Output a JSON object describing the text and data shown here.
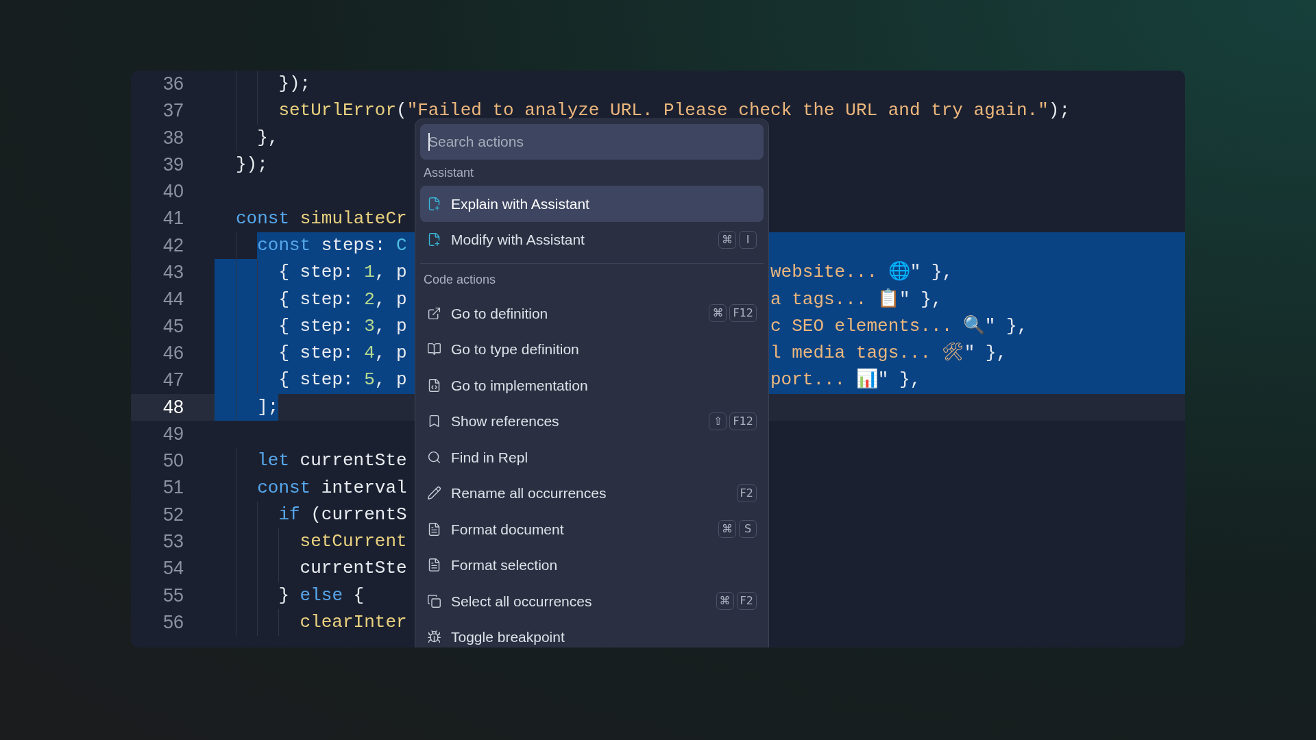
{
  "editor": {
    "lines": [
      {
        "number": "36",
        "selected": false,
        "current": false,
        "left": [
          {
            "t": "    });",
            "kind": "plain"
          }
        ]
      },
      {
        "number": "37",
        "selected": false,
        "current": false,
        "left": [
          {
            "t": "    setUrlError",
            "kind": "fn"
          },
          {
            "t": "(",
            "kind": "plain"
          },
          {
            "t": "\"Failed to analyze URL. Please check the URL and try again.\"",
            "kind": "str"
          },
          {
            "t": ");",
            "kind": "plain"
          }
        ]
      },
      {
        "number": "38",
        "selected": false,
        "current": false,
        "left": [
          {
            "t": "  },",
            "kind": "plain"
          }
        ]
      },
      {
        "number": "39",
        "selected": false,
        "current": false,
        "left": [
          {
            "t": "});",
            "kind": "plain"
          }
        ]
      },
      {
        "number": "40",
        "selected": false,
        "current": false
      },
      {
        "number": "41",
        "selected": false,
        "current": false,
        "left": [
          {
            "t": "const ",
            "kind": "kw"
          },
          {
            "t": "simulateCr",
            "kind": "fn"
          }
        ]
      },
      {
        "number": "42",
        "selected": true,
        "current": false,
        "left": [
          {
            "t": "  const ",
            "kind": "kw"
          },
          {
            "t": "steps: ",
            "kind": "plain"
          },
          {
            "t": "C",
            "kind": "type"
          }
        ]
      },
      {
        "number": "43",
        "selected": true,
        "current": false,
        "left": [
          {
            "t": "    { step: ",
            "kind": "plain"
          },
          {
            "t": "1",
            "kind": "num"
          },
          {
            "t": ", p",
            "kind": "plain"
          }
        ],
        "right": [
          {
            "t": "website... 🌐",
            "kind": "str"
          },
          {
            "t": "\" },",
            "kind": "plain"
          }
        ]
      },
      {
        "number": "44",
        "selected": true,
        "current": false,
        "left": [
          {
            "t": "    { step: ",
            "kind": "plain"
          },
          {
            "t": "2",
            "kind": "num"
          },
          {
            "t": ", p",
            "kind": "plain"
          }
        ],
        "right": [
          {
            "t": "a tags... 📋",
            "kind": "str"
          },
          {
            "t": "\" },",
            "kind": "plain"
          }
        ]
      },
      {
        "number": "45",
        "selected": true,
        "current": false,
        "left": [
          {
            "t": "    { step: ",
            "kind": "plain"
          },
          {
            "t": "3",
            "kind": "num"
          },
          {
            "t": ", p",
            "kind": "plain"
          }
        ],
        "right": [
          {
            "t": "c SEO elements... 🔍",
            "kind": "str"
          },
          {
            "t": "\" },",
            "kind": "plain"
          }
        ]
      },
      {
        "number": "46",
        "selected": true,
        "current": false,
        "left": [
          {
            "t": "    { step: ",
            "kind": "plain"
          },
          {
            "t": "4",
            "kind": "num"
          },
          {
            "t": ", p",
            "kind": "plain"
          }
        ],
        "right": [
          {
            "t": "l media tags... 🛠",
            "kind": "str"
          },
          {
            "t": "\" },",
            "kind": "plain"
          }
        ]
      },
      {
        "number": "47",
        "selected": true,
        "current": false,
        "left": [
          {
            "t": "    { step: ",
            "kind": "plain"
          },
          {
            "t": "5",
            "kind": "num"
          },
          {
            "t": ", p",
            "kind": "plain"
          }
        ],
        "right": [
          {
            "t": "port... 📊",
            "kind": "str"
          },
          {
            "t": "\" },",
            "kind": "plain"
          }
        ]
      },
      {
        "number": "48",
        "selected": true,
        "current": true,
        "left": [
          {
            "t": "  ];",
            "kind": "plain"
          }
        ]
      },
      {
        "number": "49",
        "selected": false,
        "current": false
      },
      {
        "number": "50",
        "selected": false,
        "current": false,
        "left": [
          {
            "t": "  let ",
            "kind": "kw"
          },
          {
            "t": "currentSte",
            "kind": "plain"
          }
        ]
      },
      {
        "number": "51",
        "selected": false,
        "current": false,
        "left": [
          {
            "t": "  const ",
            "kind": "kw"
          },
          {
            "t": "interval",
            "kind": "plain"
          }
        ]
      },
      {
        "number": "52",
        "selected": false,
        "current": false,
        "left": [
          {
            "t": "    if ",
            "kind": "kw"
          },
          {
            "t": "(currentS",
            "kind": "plain"
          }
        ]
      },
      {
        "number": "53",
        "selected": false,
        "current": false,
        "left": [
          {
            "t": "      setCurrent",
            "kind": "fn"
          }
        ]
      },
      {
        "number": "54",
        "selected": false,
        "current": false,
        "left": [
          {
            "t": "      currentSte",
            "kind": "plain"
          }
        ]
      },
      {
        "number": "55",
        "selected": false,
        "current": false,
        "left": [
          {
            "t": "    } ",
            "kind": "plain"
          },
          {
            "t": "else ",
            "kind": "kw"
          },
          {
            "t": "{",
            "kind": "plain"
          }
        ]
      },
      {
        "number": "56",
        "selected": false,
        "current": false,
        "left": [
          {
            "t": "      clearInter",
            "kind": "fn"
          }
        ]
      }
    ]
  },
  "menu": {
    "search": {
      "placeholder": "Search actions"
    },
    "sections": [
      {
        "title": "Assistant",
        "items": [
          {
            "kind": "explain",
            "label": "Explain with Assistant",
            "selected": true
          },
          {
            "kind": "modify",
            "label": "Modify with Assistant",
            "keys": [
              "⌘",
              "I"
            ],
            "selected": false
          }
        ]
      },
      {
        "title": "Code actions",
        "items": [
          {
            "kind": "definition",
            "label": "Go to definition",
            "keys": [
              "⌘",
              "F12"
            ],
            "selected": false
          },
          {
            "kind": "typedef",
            "label": "Go to type definition",
            "selected": false
          },
          {
            "kind": "implementation",
            "label": "Go to implementation",
            "selected": false
          },
          {
            "kind": "references",
            "label": "Show references",
            "keys": [
              "⇧",
              "F12"
            ],
            "selected": false
          },
          {
            "kind": "find",
            "label": "Find in Repl",
            "selected": false
          },
          {
            "kind": "rename",
            "label": "Rename all occurrences",
            "keys": [
              "F2"
            ],
            "selected": false
          },
          {
            "kind": "format",
            "label": "Format document",
            "keys": [
              "⌘",
              "S"
            ],
            "selected": false
          },
          {
            "kind": "format",
            "label": "Format selection",
            "selected": false
          },
          {
            "kind": "selectall",
            "label": "Select all occurrences",
            "keys": [
              "⌘",
              "F2"
            ],
            "selected": false
          },
          {
            "kind": "breakpoint",
            "label": "Toggle breakpoint",
            "selected": false
          }
        ]
      }
    ]
  }
}
